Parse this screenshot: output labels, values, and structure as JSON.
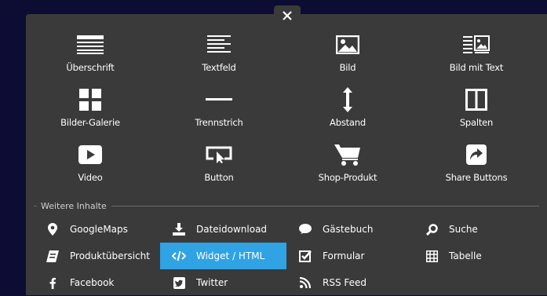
{
  "close_label": "×",
  "tiles": [
    {
      "label": "Überschrift",
      "icon": "heading-icon"
    },
    {
      "label": "Textfeld",
      "icon": "textfield-icon"
    },
    {
      "label": "Bild",
      "icon": "image-icon"
    },
    {
      "label": "Bild mit Text",
      "icon": "image-with-text-icon"
    },
    {
      "label": "Bilder-Galerie",
      "icon": "gallery-icon"
    },
    {
      "label": "Trennstrich",
      "icon": "divider-icon"
    },
    {
      "label": "Abstand",
      "icon": "spacing-icon"
    },
    {
      "label": "Spalten",
      "icon": "columns-icon"
    },
    {
      "label": "Video",
      "icon": "video-icon"
    },
    {
      "label": "Button",
      "icon": "button-icon"
    },
    {
      "label": "Shop-Produkt",
      "icon": "shopping-cart-icon"
    },
    {
      "label": "Share Buttons",
      "icon": "share-icon"
    }
  ],
  "more_title": "Weitere Inhalte",
  "more_items": [
    {
      "label": "GoogleMaps",
      "icon": "map-marker-icon"
    },
    {
      "label": "Dateidownload",
      "icon": "download-icon"
    },
    {
      "label": "Gästebuch",
      "icon": "speech-bubble-icon"
    },
    {
      "label": "Suche",
      "icon": "search-icon"
    },
    {
      "label": "Produktübersicht",
      "icon": "product-overview-icon"
    },
    {
      "label": "Widget / HTML",
      "icon": "code-icon",
      "active": true
    },
    {
      "label": "Formular",
      "icon": "checkbox-icon"
    },
    {
      "label": "Tabelle",
      "icon": "table-icon"
    },
    {
      "label": "Facebook",
      "icon": "facebook-icon"
    },
    {
      "label": "Twitter",
      "icon": "twitter-icon"
    },
    {
      "label": "RSS Feed",
      "icon": "rss-icon"
    }
  ],
  "colors": {
    "panel": "#3a3a3a",
    "backdrop": "#0d0d33",
    "active": "#2fa3e3",
    "text": "#ffffff"
  }
}
